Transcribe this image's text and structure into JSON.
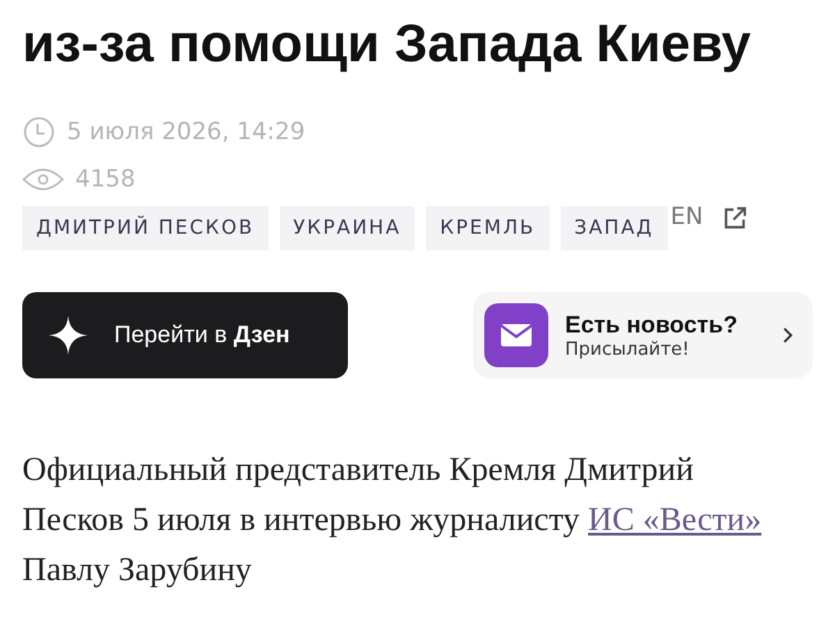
{
  "headline": "из-за помощи Запада Киеву",
  "date": "5 июля 2026, 14:29",
  "views": "4158",
  "tags": [
    "ДМИТРИЙ ПЕСКОВ",
    "УКРАИНА",
    "КРЕМЛЬ",
    "ЗАПАД"
  ],
  "language_link": "EN",
  "dzen_button": {
    "text": "Перейти в ",
    "bold": "Дзен"
  },
  "news_card": {
    "title": "Есть новость?",
    "subtitle": "Присылайте!"
  },
  "paragraph": {
    "before": "Официальный представитель Кремля Дмитрий Песков 5 июля в интервью журналисту",
    "link": "ИС «Вести»",
    "after": "Павлу Зарубину"
  }
}
